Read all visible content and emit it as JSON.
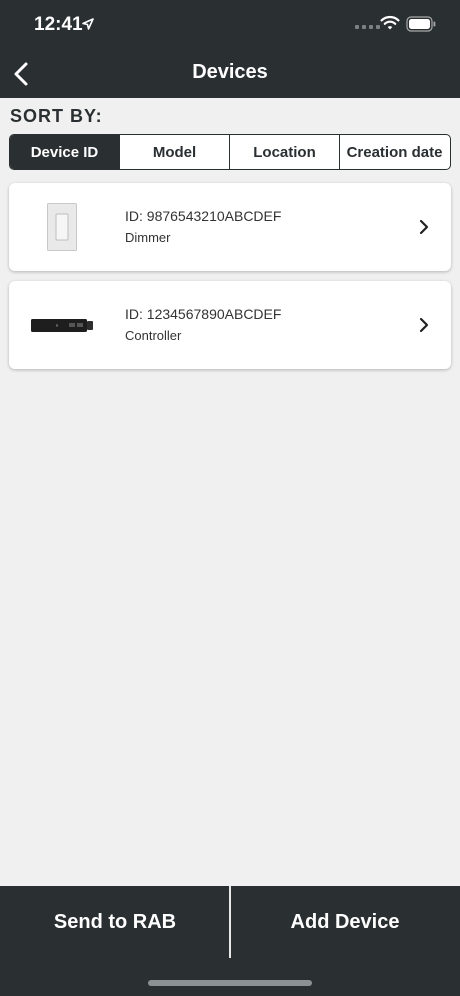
{
  "status_bar": {
    "time": "12:41",
    "icons": [
      "location-arrow-icon",
      "cellular-signal-icon",
      "wifi-icon",
      "battery-icon"
    ]
  },
  "nav": {
    "title": "Devices",
    "back_icon": "chevron-left-icon"
  },
  "sort": {
    "label": "SORT BY:",
    "options": [
      {
        "label": "Device ID",
        "active": true
      },
      {
        "label": "Model",
        "active": false
      },
      {
        "label": "Location",
        "active": false
      },
      {
        "label": "Creation date",
        "active": false
      }
    ]
  },
  "devices": [
    {
      "id_text": "ID: 9876543210ABCDEF",
      "model": "Dimmer",
      "icon": "wall-dimmer-icon"
    },
    {
      "id_text": "ID: 1234567890ABCDEF",
      "model": "Controller",
      "icon": "controller-icon"
    }
  ],
  "bottom_bar": {
    "send_label": "Send to RAB",
    "add_label": "Add Device"
  },
  "colors": {
    "header_bg": "#2a2f31",
    "page_bg": "#f0f0f0",
    "card_bg": "#ffffff"
  }
}
